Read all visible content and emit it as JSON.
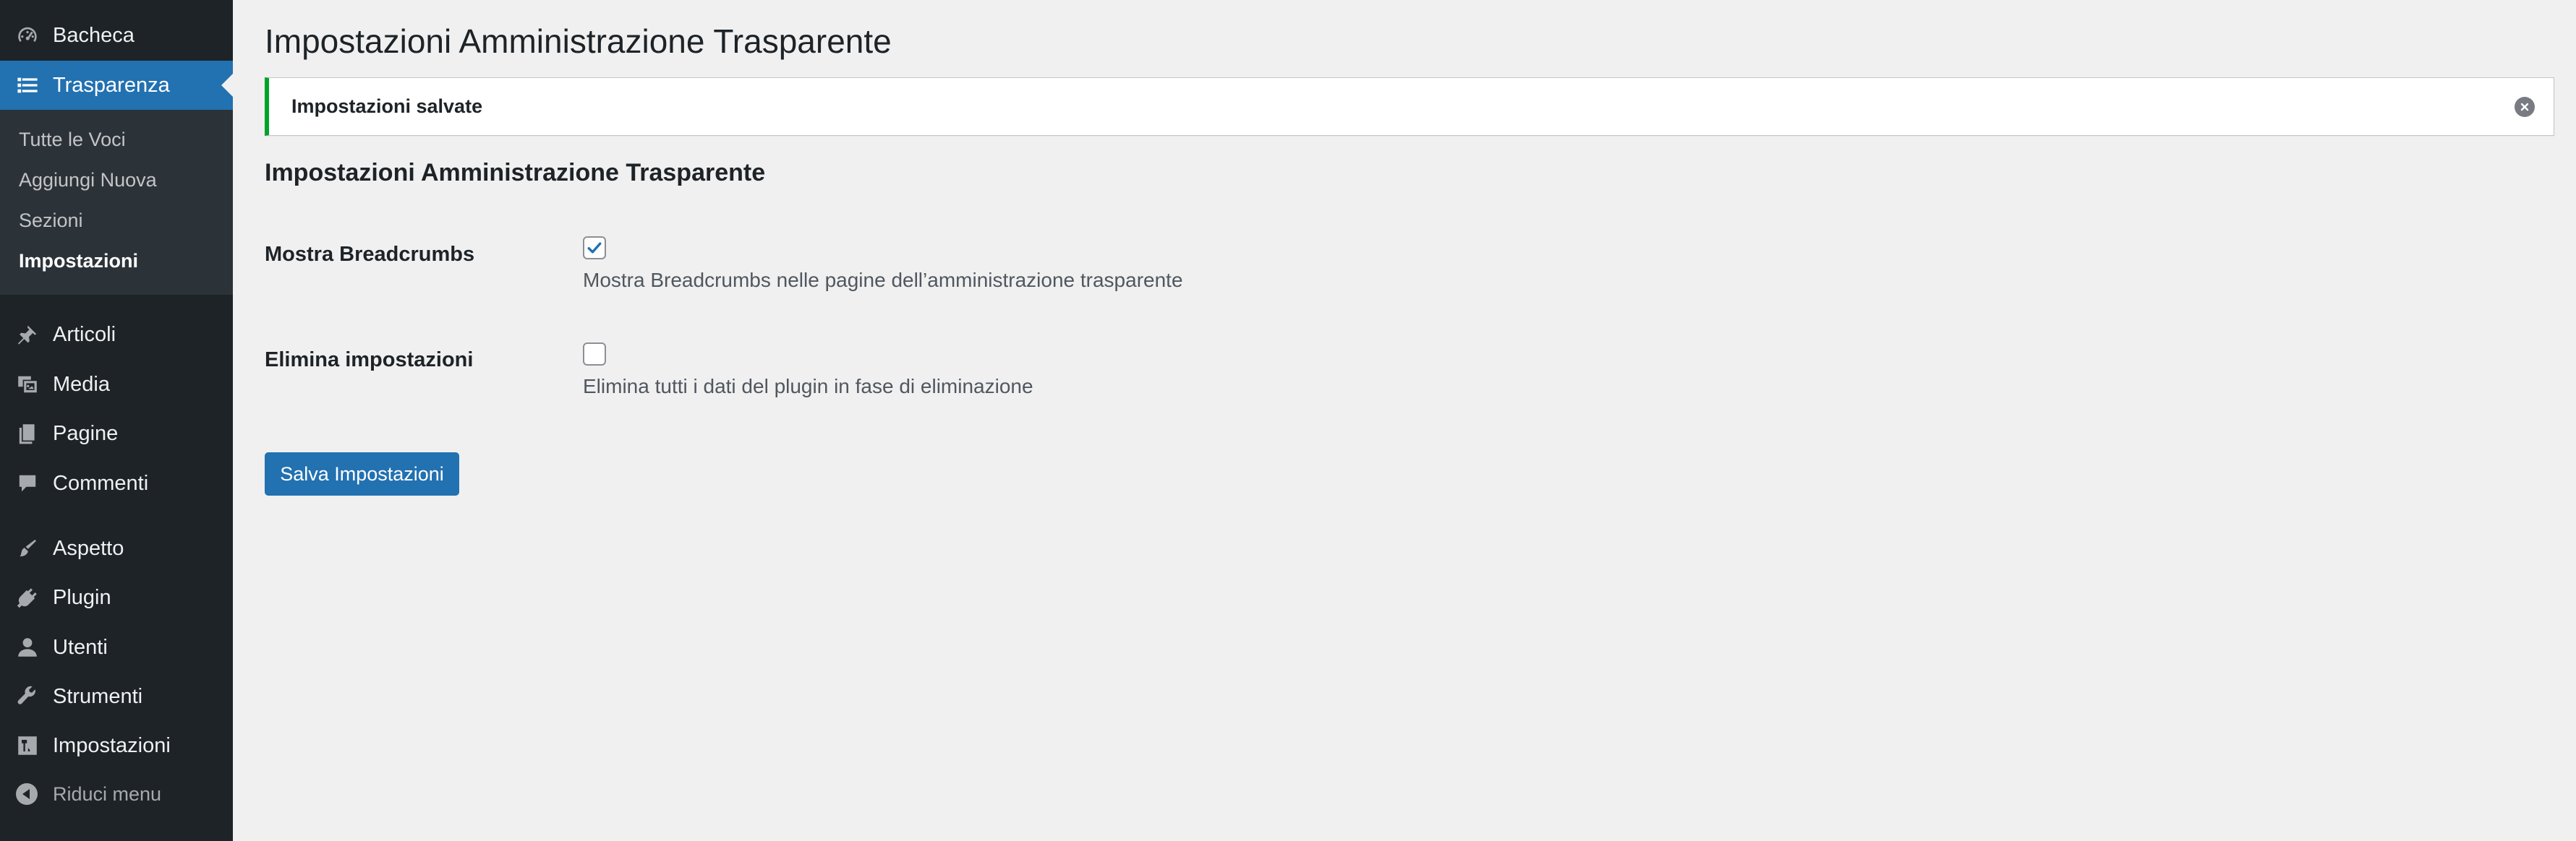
{
  "sidebar": {
    "menu_top": [
      {
        "label": "Bacheca",
        "icon": "dashboard-icon"
      },
      {
        "label": "Trasparenza",
        "icon": "list-icon"
      }
    ],
    "submenu": [
      {
        "label": "Tutte le Voci"
      },
      {
        "label": "Aggiungi Nuova"
      },
      {
        "label": "Sezioni"
      },
      {
        "label": "Impostazioni",
        "active": true
      }
    ],
    "menu_bottom": [
      {
        "label": "Articoli",
        "icon": "pushpin-icon"
      },
      {
        "label": "Media",
        "icon": "media-icon"
      },
      {
        "label": "Pagine",
        "icon": "pages-icon"
      },
      {
        "label": "Commenti",
        "icon": "comment-icon"
      },
      {
        "label": "Aspetto",
        "icon": "paintbrush-icon"
      },
      {
        "label": "Plugin",
        "icon": "plugin-icon"
      },
      {
        "label": "Utenti",
        "icon": "user-icon"
      },
      {
        "label": "Strumenti",
        "icon": "wrench-icon"
      },
      {
        "label": "Impostazioni",
        "icon": "settings-sliders-icon"
      }
    ],
    "collapse_label": "Riduci menu",
    "colors": {
      "background": "#1d2327",
      "submenu_background": "#2c3338",
      "accent": "#2271b1"
    }
  },
  "page": {
    "title": "Impostazioni Amministrazione Trasparente",
    "notice": "Impostazioni salvate",
    "section_title": "Impostazioni Amministrazione Trasparente",
    "fields": [
      {
        "label": "Mostra Breadcrumbs",
        "checked": true,
        "description": "Mostra Breadcrumbs nelle pagine dell’amministrazione trasparente"
      },
      {
        "label": "Elimina impostazioni",
        "checked": false,
        "description": "Elimina tutti i dati del plugin in fase di eliminazione"
      }
    ],
    "save_button": "Salva Impostazioni",
    "colors": {
      "notice_border": "#00a32a",
      "button": "#2271b1"
    }
  }
}
